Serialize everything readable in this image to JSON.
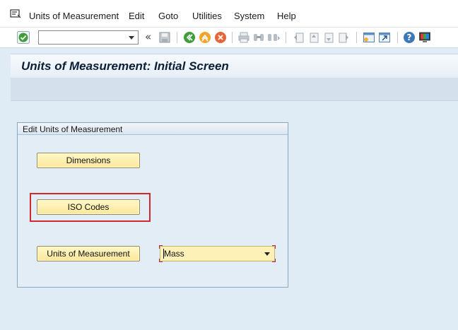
{
  "menu": {
    "items": [
      {
        "label": "Units of Measurement"
      },
      {
        "label": "Edit"
      },
      {
        "label": "Goto"
      },
      {
        "label": "Utilities"
      },
      {
        "label": "System"
      },
      {
        "label": "Help"
      }
    ]
  },
  "toolbar": {
    "command_field_value": "",
    "chevron": "«"
  },
  "title": {
    "text": "Units of Measurement: Initial Screen"
  },
  "group": {
    "title": "Edit Units of Measurement",
    "buttons": {
      "dimensions": "Dimensions",
      "iso_codes": "ISO Codes",
      "units": "Units of Measurement"
    },
    "dropdown": {
      "value": "Mass"
    }
  },
  "colors": {
    "button_fill": "#fbe79a",
    "highlight": "#d12a2a",
    "title_text": "#0b1f36",
    "background": "#dfebf5"
  }
}
